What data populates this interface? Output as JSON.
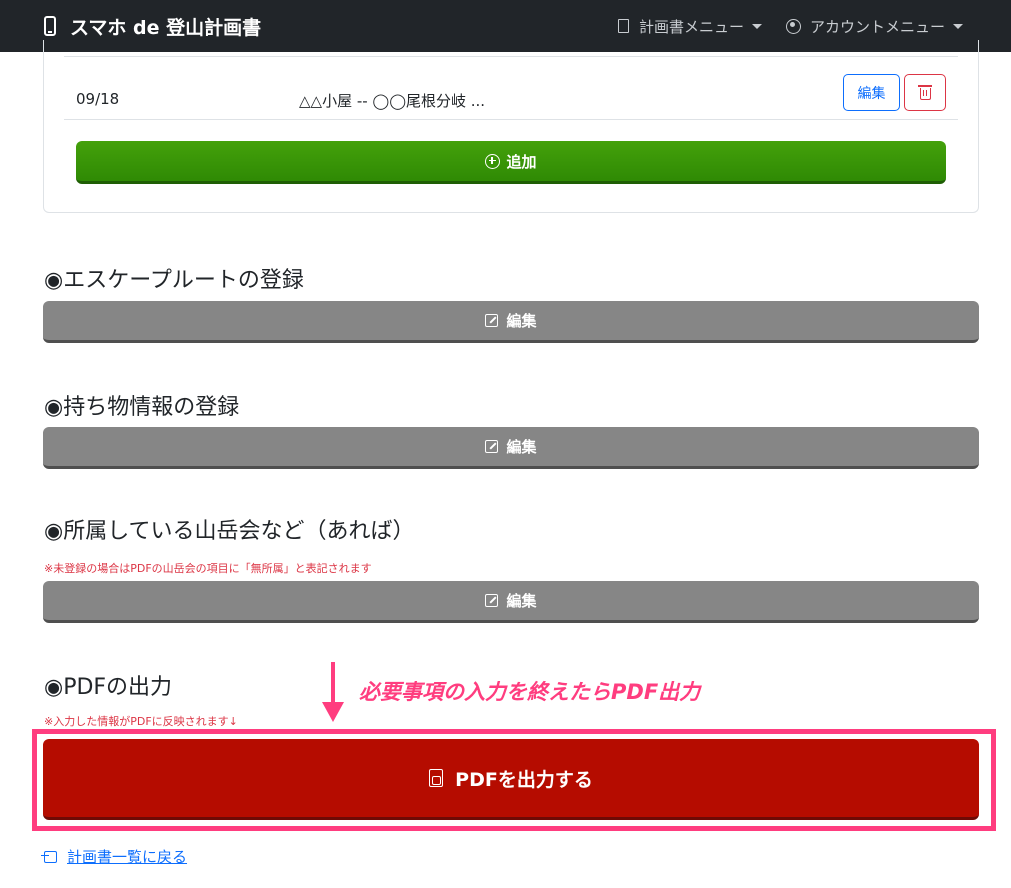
{
  "navbar": {
    "brand": "スマホ de 登山計画書",
    "plan_menu": "計画書メニュー",
    "account_menu": "アカウントメニュー"
  },
  "schedule": {
    "rows": [
      {
        "date": "09/18",
        "route": "△△小屋 -- ◯◯尾根分岐 ...",
        "edit_label": "編集"
      }
    ],
    "add_label": "追加"
  },
  "sections": {
    "escape": {
      "title": "◉エスケープルートの登録",
      "button": "編集"
    },
    "items": {
      "title": "◉持ち物情報の登録",
      "button": "編集"
    },
    "club": {
      "title": "◉所属している山岳会など（あれば）",
      "note": "※未登録の場合はPDFの山岳会の項目に「無所属」と表記されます",
      "button": "編集"
    },
    "pdf": {
      "title": "◉PDFの出力",
      "note": "※入力した情報がPDFに反映されます↓",
      "button": "PDFを出力する"
    }
  },
  "annotation": {
    "callout": "必要事項の入力を終えたらPDF出力"
  },
  "footer": {
    "back_link": "計画書一覧に戻る"
  },
  "colors": {
    "navbar": "#212529",
    "add_button": "#3a9a08",
    "gray_button": "#868686",
    "pdf_button": "#b50c00",
    "highlight": "#ff3d7f",
    "link": "#0d6efd",
    "danger": "#dc3545"
  },
  "icons": [
    "smartphone-icon",
    "document-icon",
    "user-circle-icon",
    "trash-icon",
    "plus-circle-icon",
    "pencil-square-icon",
    "file-pdf-icon",
    "box-arrow-left-icon",
    "arrow-down-annotation"
  ]
}
